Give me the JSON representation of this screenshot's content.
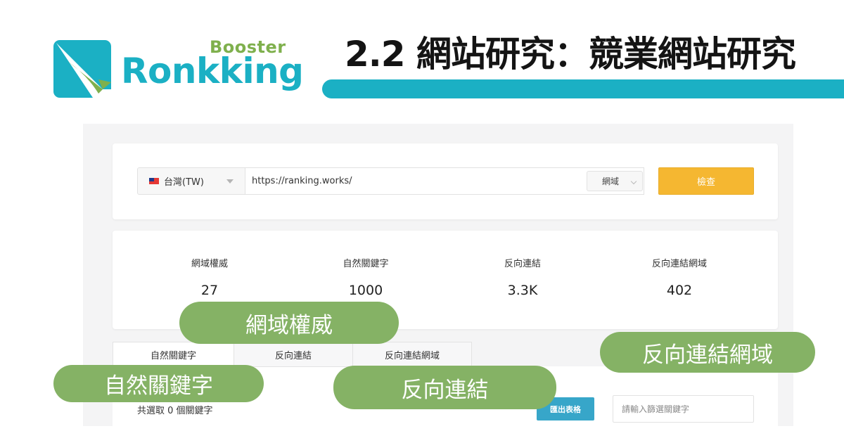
{
  "header": {
    "logo_booster": "Booster",
    "logo_word": "Ronkking",
    "title": "2.2 網站研究：競業網站研究",
    "colors": {
      "brand_teal": "#1bb0c4",
      "brand_green": "#7fb04d"
    }
  },
  "search": {
    "country_label": "台灣(TW)",
    "url_value": "https://ranking.works/",
    "scope_label": "網域",
    "check_label": "檢查",
    "check_color": "#f5b731"
  },
  "stats": [
    {
      "label": "網域權威",
      "value": "27"
    },
    {
      "label": "自然關鍵字",
      "value": "1000"
    },
    {
      "label": "反向連結",
      "value": "3.3K"
    },
    {
      "label": "反向連結網域",
      "value": "402"
    }
  ],
  "tabs": [
    {
      "label": "自然關鍵字",
      "active": true
    },
    {
      "label": "反向連結",
      "active": false
    },
    {
      "label": "反向連結網域",
      "active": false
    }
  ],
  "table_controls": {
    "selected_count": "共選取 0 個關鍵字",
    "export_label": "匯出表格",
    "filter_placeholder": "請輸入篩選關鍵字"
  },
  "annotations": [
    {
      "text": "網域權威"
    },
    {
      "text": "反向連結網域"
    },
    {
      "text": "自然關鍵字"
    },
    {
      "text": "反向連結"
    }
  ]
}
